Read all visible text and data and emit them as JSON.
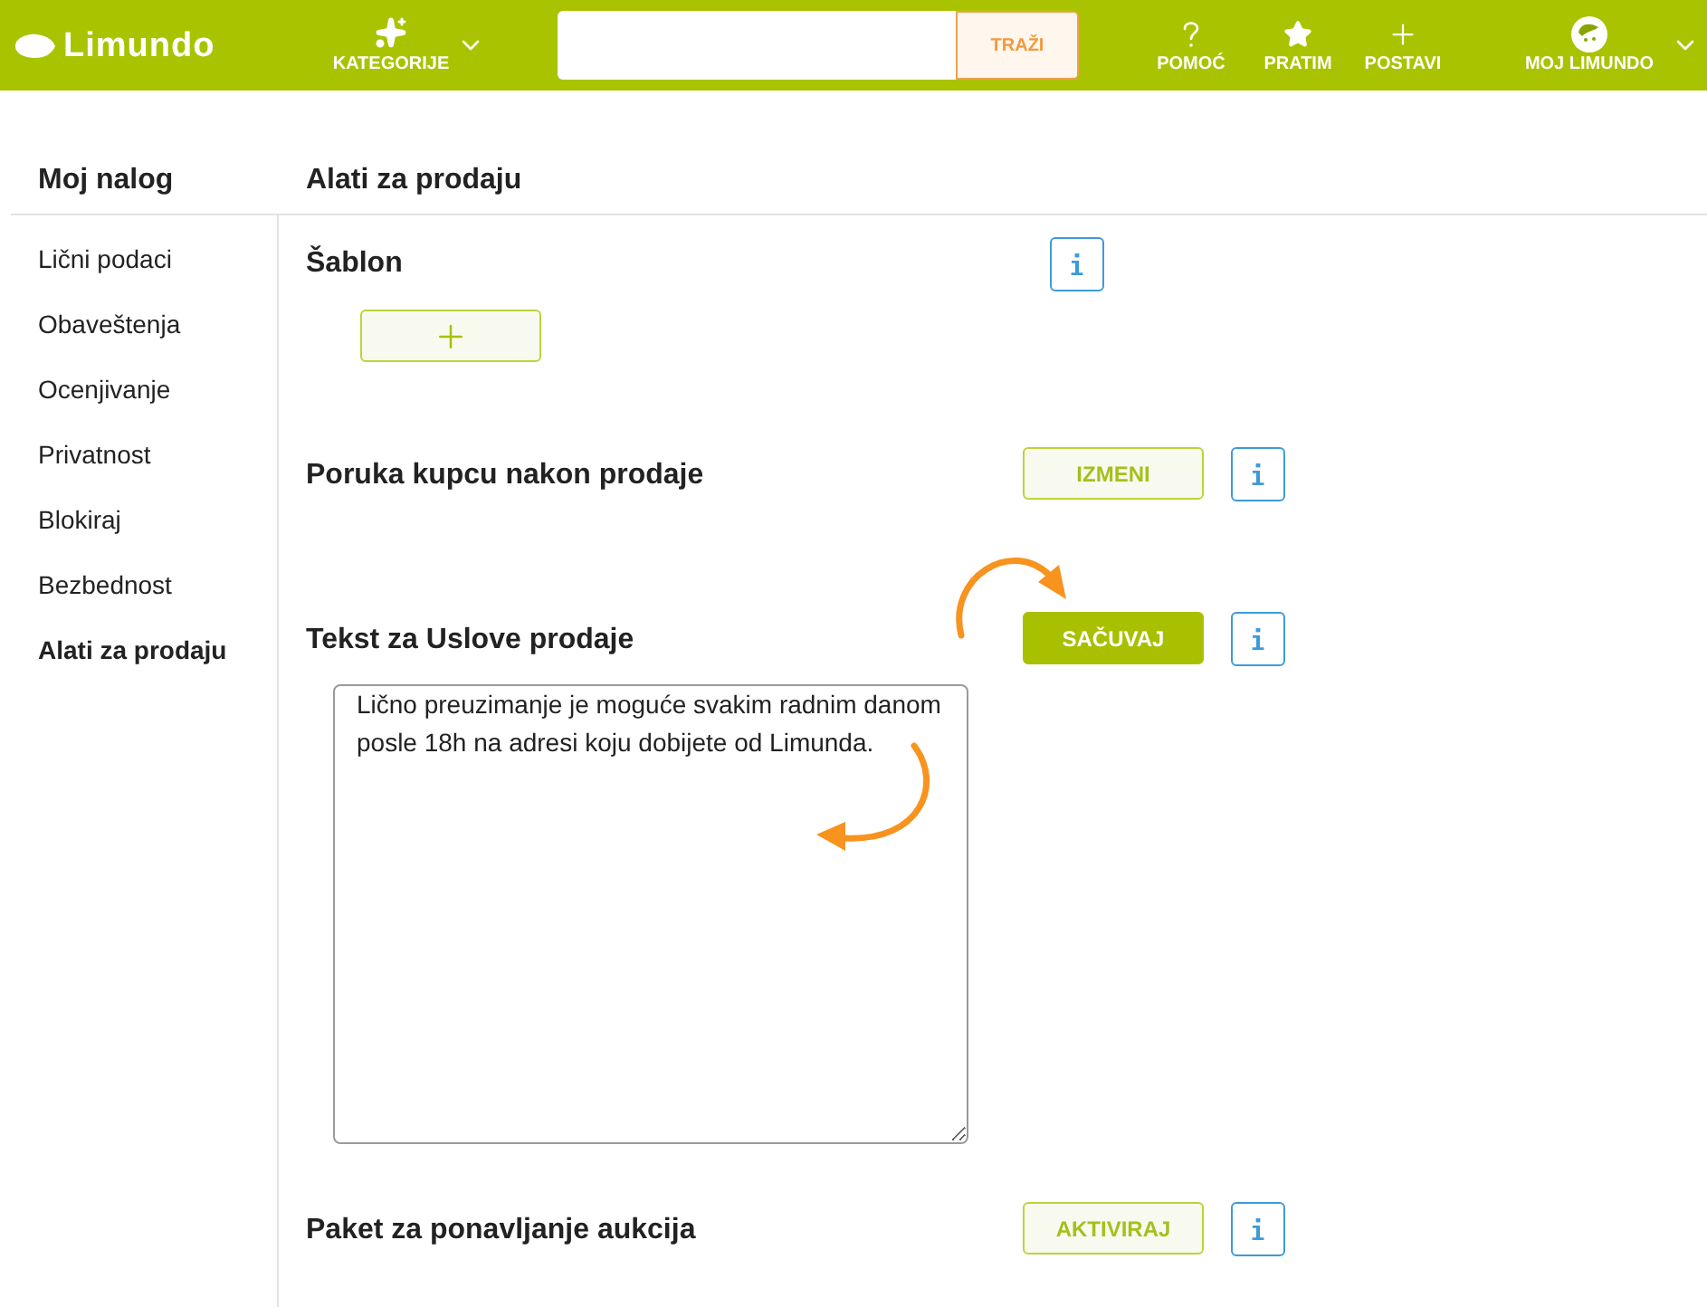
{
  "header": {
    "logo": "Limundo",
    "categories": {
      "label": "KATEGORIJE"
    },
    "search": {
      "button": "TRAŽI"
    },
    "actions": [
      {
        "kind": "help",
        "label": "POMOĆ"
      },
      {
        "kind": "star",
        "label": "PRATIM"
      },
      {
        "kind": "plus",
        "label": "POSTAVI"
      },
      {
        "kind": "account",
        "label": "MOJ LIMUNDO"
      }
    ]
  },
  "sidebar": {
    "title": "Moj nalog",
    "items": [
      {
        "label": "Lični podaci",
        "selected": false
      },
      {
        "label": "Obaveštenja",
        "selected": false
      },
      {
        "label": "Ocenjivanje",
        "selected": false
      },
      {
        "label": "Privatnost",
        "selected": false
      },
      {
        "label": "Blokiraj",
        "selected": false
      },
      {
        "label": "Bezbednost",
        "selected": false
      },
      {
        "label": "Alati za prodaju",
        "selected": true
      }
    ]
  },
  "main": {
    "title": "Alati za prodaju",
    "sections": [
      {
        "kind": "template",
        "title": "Šablon"
      },
      {
        "kind": "action",
        "title": "Poruka kupcu nakon prodaje",
        "button": {
          "label": "IZMENI",
          "primary": false
        }
      },
      {
        "kind": "editor",
        "title": "Tekst za Uslove prodaje",
        "button": {
          "label": "SAČUVAJ",
          "primary": true
        },
        "text": "Lično preuzimanje je moguće svakim radnim danom posle 18h na adresi koju dobijete od Limunda."
      },
      {
        "kind": "action",
        "title": "Paket za ponavljanje aukcija",
        "button": {
          "label": "AKTIVIRAJ",
          "primary": false
        }
      }
    ]
  }
}
